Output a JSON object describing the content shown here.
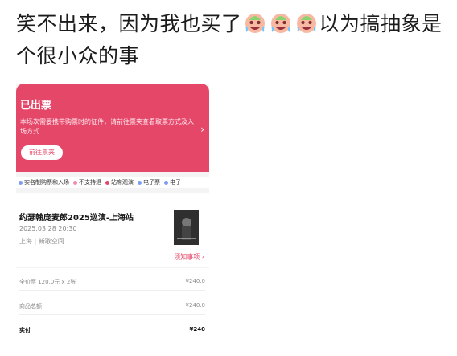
{
  "post": {
    "text_before_emoji": "笑不出来，因为我也买了",
    "text_after_emoji": "以为搞抽象是个很小众的事",
    "emoji": [
      "crying-laughing-face-emoji",
      "crying-laughing-face-emoji",
      "crying-laughing-face-emoji"
    ]
  },
  "screenshot": {
    "banner": {
      "title": "已出票",
      "description": "本场次需要携带购票时的证件，请前往票夹查看取票方式及入场方式",
      "button_label": "前往票夹",
      "chevron": "›",
      "color": "#e54769"
    },
    "features": [
      {
        "label": "实名制购票和入场",
        "dot_color": "#7f9cf5"
      },
      {
        "label": "不支持退",
        "dot_color": "#f28aa8"
      },
      {
        "label": "站席观演",
        "dot_color": "#e54769"
      },
      {
        "label": "电子票",
        "dot_color": "#7f9cf5"
      },
      {
        "label": "电子",
        "dot_color": "#7f9cf5"
      }
    ],
    "event": {
      "title": "约瑟翰庞麦郎2025巡演-上海站",
      "datetime": "2025.03.28 20:30",
      "venue": "上海 | 新歌空间",
      "notice_label": "须知事项 ›"
    },
    "pricing": {
      "rows": [
        {
          "label": "全价票 120.0元 x 2张",
          "value": "¥240.0"
        },
        {
          "label": "商品总额",
          "value": "¥240.0"
        },
        {
          "label": "实付",
          "value": "¥240"
        }
      ]
    }
  }
}
